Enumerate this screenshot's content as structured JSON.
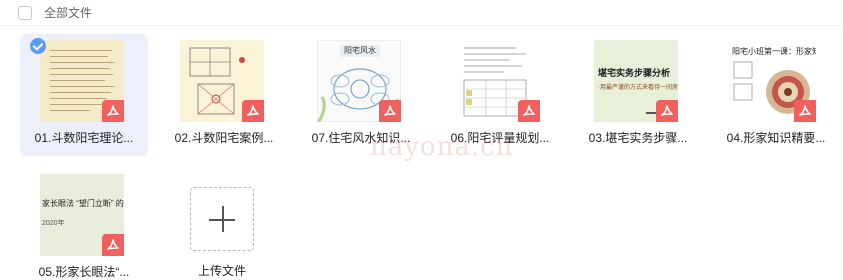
{
  "header": {
    "select_all_label": "全部文件"
  },
  "files": [
    {
      "name": "01.斗数阳宅理论...",
      "type": "pdf",
      "selected": true
    },
    {
      "name": "02.斗数阳宅案例...",
      "type": "pdf",
      "selected": false
    },
    {
      "name": "07.住宅风水知识...",
      "type": "pdf",
      "selected": false,
      "thumb_text": "阳宅风水"
    },
    {
      "name": "06.阳宅评量规划...",
      "type": "pdf",
      "selected": false
    },
    {
      "name": "03.堪宅实务步骤...",
      "type": "pdf",
      "selected": false,
      "thumb_title": "堪宅实务步骤分析",
      "thumb_sub": "·用最严谨的方式来看待一间房"
    },
    {
      "name": "04.形家知识精要...",
      "type": "pdf",
      "selected": false,
      "thumb_title": "阳宅小班第一课：形家知识"
    },
    {
      "name": "05.形家长眼法“...",
      "type": "pdf",
      "selected": false,
      "thumb_title": "家长眼法 “望门立断” 的",
      "thumb_sub": "2020年"
    }
  ],
  "upload": {
    "label": "上传文件"
  },
  "watermark": "nayona.cn",
  "colors": {
    "selected_bg": "#edf0fb",
    "check": "#5b9cf2",
    "pdf_badge": "#f0605e"
  }
}
